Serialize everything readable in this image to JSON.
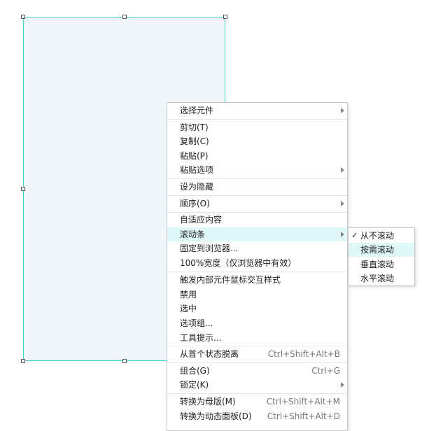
{
  "context_menu": {
    "items": [
      {
        "label": "选择元件",
        "shortcut": "",
        "submenu": true
      },
      {
        "label": "剪切(T)",
        "shortcut": "",
        "submenu": false
      },
      {
        "label": "复制(C)",
        "shortcut": "",
        "submenu": false
      },
      {
        "label": "粘贴(P)",
        "shortcut": "",
        "submenu": false
      },
      {
        "label": "粘贴选项",
        "shortcut": "",
        "submenu": true
      },
      {
        "label": "设为隐藏",
        "shortcut": "",
        "submenu": false
      },
      {
        "label": "顺序(O)",
        "shortcut": "",
        "submenu": true
      },
      {
        "label": "自适应内容",
        "shortcut": "",
        "submenu": false
      },
      {
        "label": "滚动条",
        "shortcut": "",
        "submenu": true
      },
      {
        "label": "固定到浏览器...",
        "shortcut": "",
        "submenu": false
      },
      {
        "label": "100%宽度（仅浏览器中有效）",
        "shortcut": "",
        "submenu": false
      },
      {
        "label": "触发内部元件鼠标交互样式",
        "shortcut": "",
        "submenu": false
      },
      {
        "label": "禁用",
        "shortcut": "",
        "submenu": false
      },
      {
        "label": "选中",
        "shortcut": "",
        "submenu": false
      },
      {
        "label": "选项组...",
        "shortcut": "",
        "submenu": false
      },
      {
        "label": "工具提示...",
        "shortcut": "",
        "submenu": false
      },
      {
        "label": "从首个状态脱离",
        "shortcut": "Ctrl+Shift+Alt+B",
        "submenu": false
      },
      {
        "label": "组合(G)",
        "shortcut": "Ctrl+G",
        "submenu": false
      },
      {
        "label": "锁定(K)",
        "shortcut": "",
        "submenu": true
      },
      {
        "label": "转换为母版(M)",
        "shortcut": "Ctrl+Shift+Alt+M",
        "submenu": false
      },
      {
        "label": "转换为动态面板(D)",
        "shortcut": "Ctrl+Shift+Alt+D",
        "submenu": false
      }
    ],
    "hovered_item": "滚动条"
  },
  "scroll_submenu": {
    "items": [
      {
        "label": "从不滚动",
        "checked": true
      },
      {
        "label": "按需滚动",
        "checked": false
      },
      {
        "label": "垂直滚动",
        "checked": false
      },
      {
        "label": "水平滚动",
        "checked": false
      }
    ],
    "check_mark": "✓",
    "hovered_item": "按需滚动"
  },
  "colors": {
    "panel_fill": "#f1f6fa",
    "selection_border": "#3fd0d0",
    "hover_background": "#e0f7f7"
  }
}
